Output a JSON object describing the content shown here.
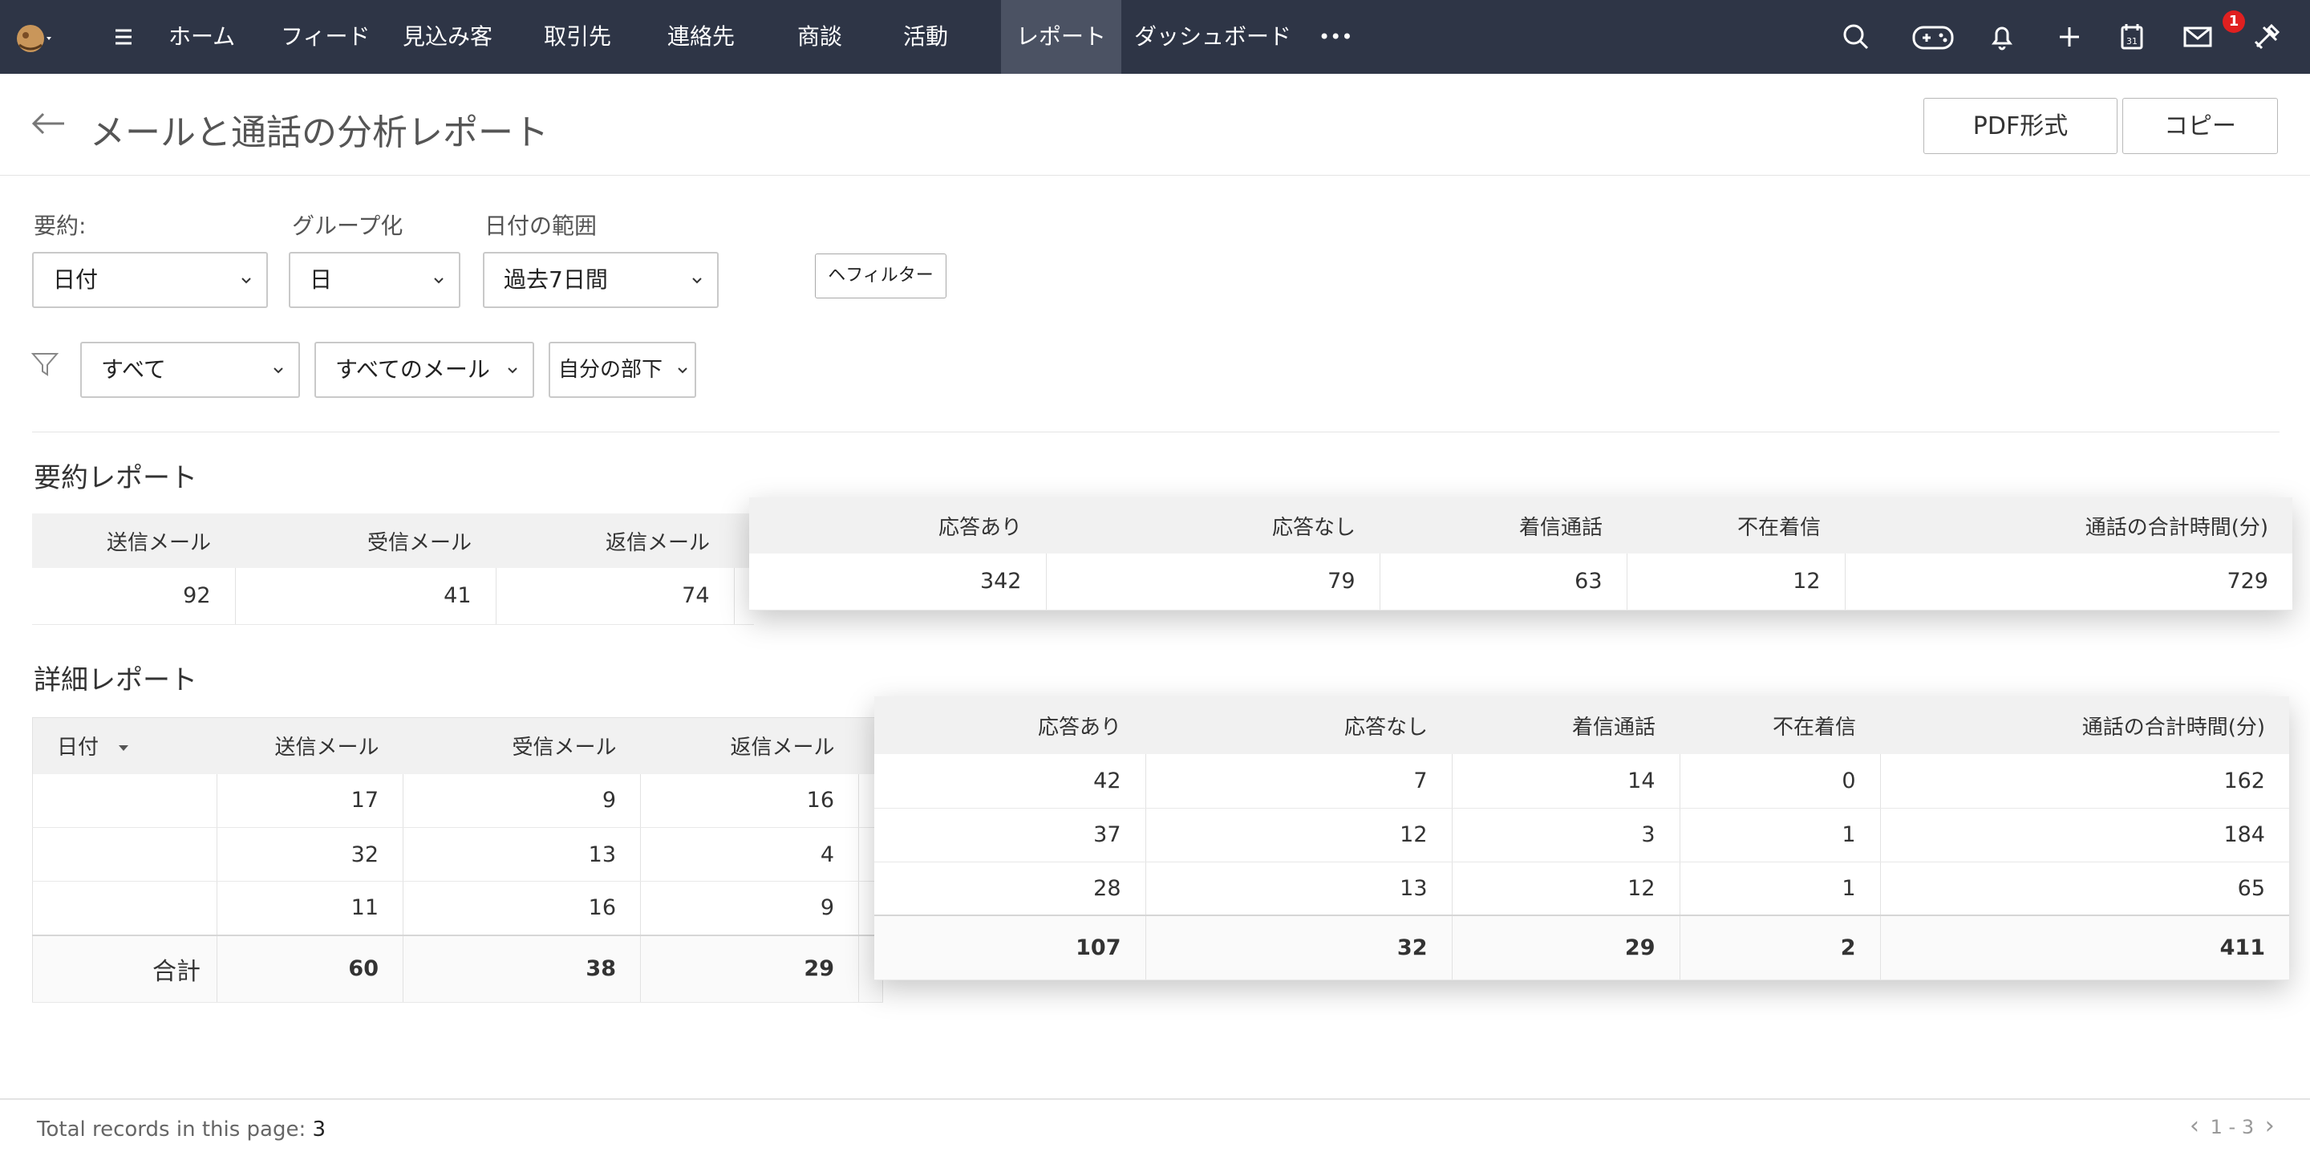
{
  "nav": {
    "items": [
      "ホーム",
      "フィード",
      "見込み客",
      "取引先",
      "連絡先",
      "商談",
      "活動",
      "レポート",
      "ダッシュボード"
    ],
    "active_index": 7,
    "more_label": "•••",
    "mail_badge": "1"
  },
  "header": {
    "title": "メールと通話の分析レポート",
    "pdf_button": "PDF形式",
    "copy_button": "コピー"
  },
  "filters": {
    "summary_label": "要約:",
    "summary_value": "日付",
    "group_label": "グループ化",
    "group_value": "日",
    "range_label": "日付の範囲",
    "range_value": "過去7日間",
    "filter_button": "ヘフィルター",
    "scope_value": "すべて",
    "mail_value": "すべてのメール",
    "team_value": "自分の部下"
  },
  "summary": {
    "title": "要約レポート",
    "left_headers": [
      "送信メール",
      "受信メール",
      "返信メール"
    ],
    "left_values": [
      "92",
      "41",
      "74"
    ],
    "right_headers": [
      "応答あり",
      "応答なし",
      "着信通話",
      "不在着信",
      "通話の合計時間(分)"
    ],
    "right_values": [
      "342",
      "79",
      "63",
      "12",
      "729"
    ]
  },
  "detail": {
    "title": "詳細レポート",
    "date_header": "日付",
    "left_headers": [
      "送信メール",
      "受信メール",
      "返信メール"
    ],
    "left_rows": [
      [
        "",
        "17",
        "9",
        "16"
      ],
      [
        "",
        "32",
        "13",
        "4"
      ],
      [
        "",
        "11",
        "16",
        "9"
      ]
    ],
    "total_label": "合計",
    "left_totals": [
      "60",
      "38",
      "29"
    ],
    "right_headers": [
      "応答あり",
      "応答なし",
      "着信通話",
      "不在着信",
      "通話の合計時間(分)"
    ],
    "right_rows": [
      [
        "42",
        "7",
        "14",
        "0",
        "162"
      ],
      [
        "37",
        "12",
        "3",
        "1",
        "184"
      ],
      [
        "28",
        "13",
        "12",
        "1",
        "65"
      ]
    ],
    "right_totals": [
      "107",
      "32",
      "29",
      "2",
      "411"
    ]
  },
  "footer": {
    "records_label": "Total records in this page:",
    "records_count": "3",
    "pager": "1 - 3"
  }
}
